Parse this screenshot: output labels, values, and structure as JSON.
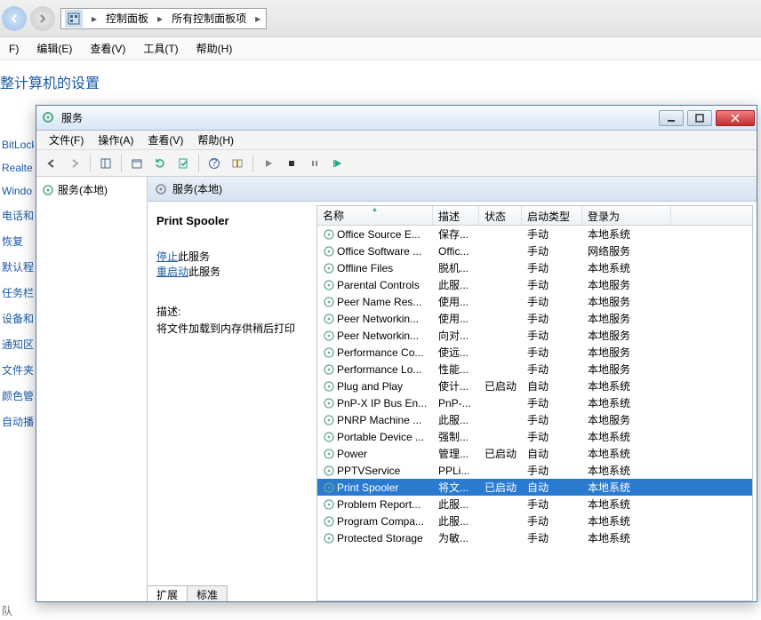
{
  "addressbar": {
    "item1": "控制面板",
    "item2": "所有控制面板项"
  },
  "mainmenu": {
    "file": "F)",
    "edit": "编辑(E)",
    "view": "查看(V)",
    "tools": "工具(T)",
    "help": "帮助(H)"
  },
  "heading": "整计算机的设置",
  "leftLinks": [
    "BitLock",
    "Realte",
    "Windo",
    "电话和",
    "恢复",
    "默认程",
    "任务栏",
    "设备和",
    "通知区",
    "文件夹",
    "颜色管",
    "自动播"
  ],
  "bottomText": "队",
  "win": {
    "title": "服务",
    "menu": {
      "file": "文件(F)",
      "action": "操作(A)",
      "view": "查看(V)",
      "help": "帮助(H)"
    },
    "tree": "服务(本地)",
    "detailHeader": "服务(本地)",
    "selected": {
      "name": "Print Spooler",
      "stopText": "停止",
      "stopSuffix": "此服务",
      "restartText": "重启动",
      "restartSuffix": "此服务",
      "descLabel": "描述:",
      "desc": "将文件加载到内存供稍后打印"
    },
    "columns": {
      "name": "名称",
      "desc": "描述",
      "status": "状态",
      "startup": "启动类型",
      "logon": "登录为"
    },
    "rows": [
      {
        "n": "Office  Source E...",
        "d": "保存...",
        "s": "",
        "t": "手动",
        "l": "本地系统"
      },
      {
        "n": "Office Software ...",
        "d": "Offic...",
        "s": "",
        "t": "手动",
        "l": "网络服务"
      },
      {
        "n": "Offline Files",
        "d": "脱机...",
        "s": "",
        "t": "手动",
        "l": "本地系统"
      },
      {
        "n": "Parental Controls",
        "d": "此服...",
        "s": "",
        "t": "手动",
        "l": "本地服务"
      },
      {
        "n": "Peer Name Res...",
        "d": "使用...",
        "s": "",
        "t": "手动",
        "l": "本地服务"
      },
      {
        "n": "Peer Networkin...",
        "d": "使用...",
        "s": "",
        "t": "手动",
        "l": "本地服务"
      },
      {
        "n": "Peer Networkin...",
        "d": "向对...",
        "s": "",
        "t": "手动",
        "l": "本地服务"
      },
      {
        "n": "Performance Co...",
        "d": "使远...",
        "s": "",
        "t": "手动",
        "l": "本地服务"
      },
      {
        "n": "Performance Lo...",
        "d": "性能...",
        "s": "",
        "t": "手动",
        "l": "本地服务"
      },
      {
        "n": "Plug and Play",
        "d": "使计...",
        "s": "已启动",
        "t": "自动",
        "l": "本地系统"
      },
      {
        "n": "PnP-X IP Bus En...",
        "d": "PnP-...",
        "s": "",
        "t": "手动",
        "l": "本地系统"
      },
      {
        "n": "PNRP Machine ...",
        "d": "此服...",
        "s": "",
        "t": "手动",
        "l": "本地服务"
      },
      {
        "n": "Portable Device ...",
        "d": "强制...",
        "s": "",
        "t": "手动",
        "l": "本地系统"
      },
      {
        "n": "Power",
        "d": "管理...",
        "s": "已启动",
        "t": "自动",
        "l": "本地系统"
      },
      {
        "n": "PPTVService",
        "d": "PPLi...",
        "s": "",
        "t": "手动",
        "l": "本地系统"
      },
      {
        "n": "Print Spooler",
        "d": "将文...",
        "s": "已启动",
        "t": "自动",
        "l": "本地系统",
        "sel": true
      },
      {
        "n": "Problem Report...",
        "d": "此服...",
        "s": "",
        "t": "手动",
        "l": "本地系统"
      },
      {
        "n": "Program Compa...",
        "d": "此服...",
        "s": "",
        "t": "手动",
        "l": "本地系统"
      },
      {
        "n": "Protected Storage",
        "d": "为敏...",
        "s": "",
        "t": "手动",
        "l": "本地系统"
      }
    ],
    "tabs": {
      "extended": "扩展",
      "standard": "标准"
    }
  }
}
